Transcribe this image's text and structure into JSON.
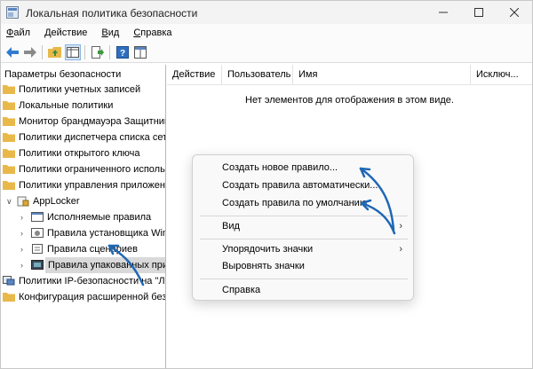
{
  "window": {
    "title": "Локальная политика безопасности"
  },
  "menubar": [
    {
      "label": "Файл",
      "ul": "Ф",
      "rest": "айл"
    },
    {
      "label": "Действие",
      "ul": "Д",
      "rest": "ействие"
    },
    {
      "label": "Вид",
      "ul": "В",
      "rest": "ид"
    },
    {
      "label": "Справка",
      "ul": "С",
      "rest": "правка"
    }
  ],
  "tree": {
    "root": "Параметры безопасности",
    "items": [
      "Политики учетных записей",
      "Локальные политики",
      "Монитор брандмауэра Защитник",
      "Политики диспетчера списка сете",
      "Политики открытого ключа",
      "Политики ограниченного использо",
      "Политики управления приложения",
      "AppLocker",
      "Исполняемые правила",
      "Правила установщика Win",
      "Правила сценариев",
      "Правила упакованных при",
      "Политики IP-безопасности на \"Ло",
      "Конфигурация расширенной безо"
    ]
  },
  "list": {
    "columns": [
      "Действие",
      "Пользователь",
      "Имя",
      "Исключ..."
    ],
    "empty_message": "Нет элементов для отображения в этом виде."
  },
  "context_menu": {
    "create_rule": "Создать новое правило...",
    "create_auto": "Создать правила автоматически...",
    "create_default": "Создать правила по умолчанию",
    "view": "Вид",
    "arrange": "Упорядочить значки",
    "line_up": "Выровнять значки",
    "help": "Справка",
    "submenu_arrow": "›"
  },
  "colors": {
    "annotation_arrow": "#1f67b5",
    "folder": "#e8b94a"
  }
}
